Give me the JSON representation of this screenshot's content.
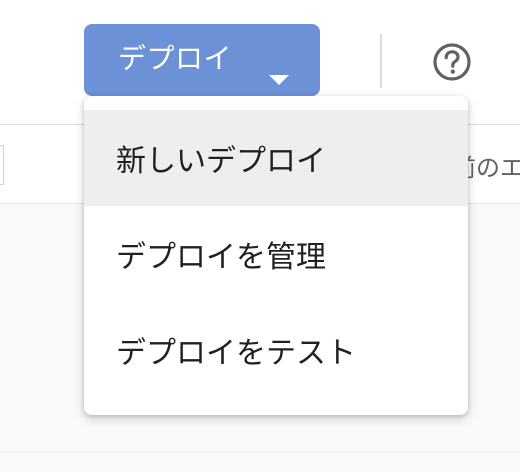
{
  "toolbar": {
    "deploy_button_label": "デプロイ",
    "help_icon": "help-circle-icon",
    "caret_icon": "caret-down-icon"
  },
  "background": {
    "partial_text": "前のエ"
  },
  "deploy_menu": {
    "items": [
      {
        "label": "新しいデプロイ",
        "highlighted": true
      },
      {
        "label": "デプロイを管理"
      },
      {
        "label": "デプロイをテスト"
      }
    ]
  },
  "colors": {
    "accent": "#6d91d6",
    "menu_highlight": "#eeeeee",
    "content_bg": "#f8f9fa",
    "text": "#202124"
  }
}
